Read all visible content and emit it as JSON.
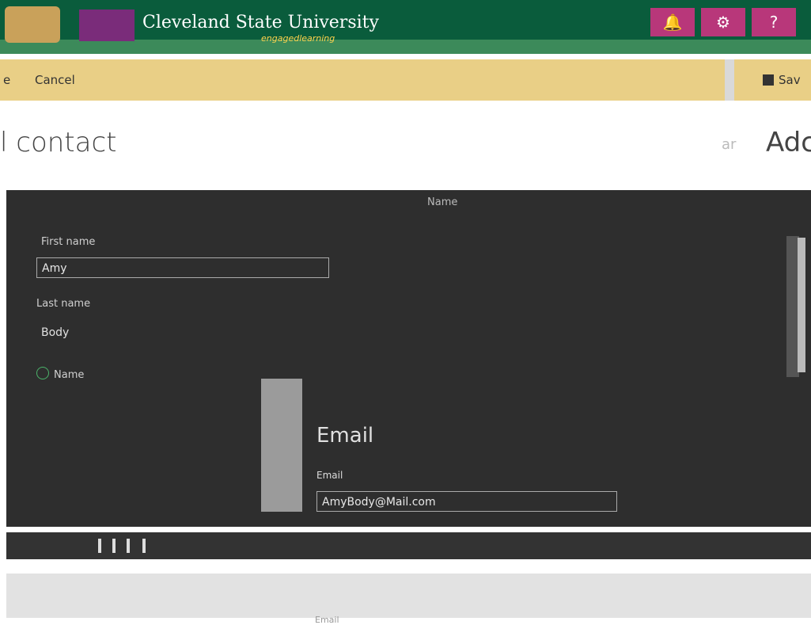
{
  "header": {
    "university_name": "Cleveland State University",
    "tagline": "engagedlearning",
    "bell_icon": "bell-icon",
    "settings_icon": "gear-icon",
    "help_label": "?"
  },
  "commandbar": {
    "left_fragment": "e",
    "cancel_label": "Cancel",
    "save_label": "Sav"
  },
  "page": {
    "title": "l contact",
    "right_title": "Adc",
    "side_letters": "ar"
  },
  "form": {
    "section_header": "Name",
    "first_name_label": "First name",
    "first_name_value": "Amy",
    "last_name_label": "Last name",
    "last_name_value": "Body",
    "name_label": "Name",
    "email_section_title": "Email",
    "email_label": "Email",
    "email_value": "AmyBody@Mail.com"
  },
  "footer": {
    "footer_text": "Email"
  }
}
